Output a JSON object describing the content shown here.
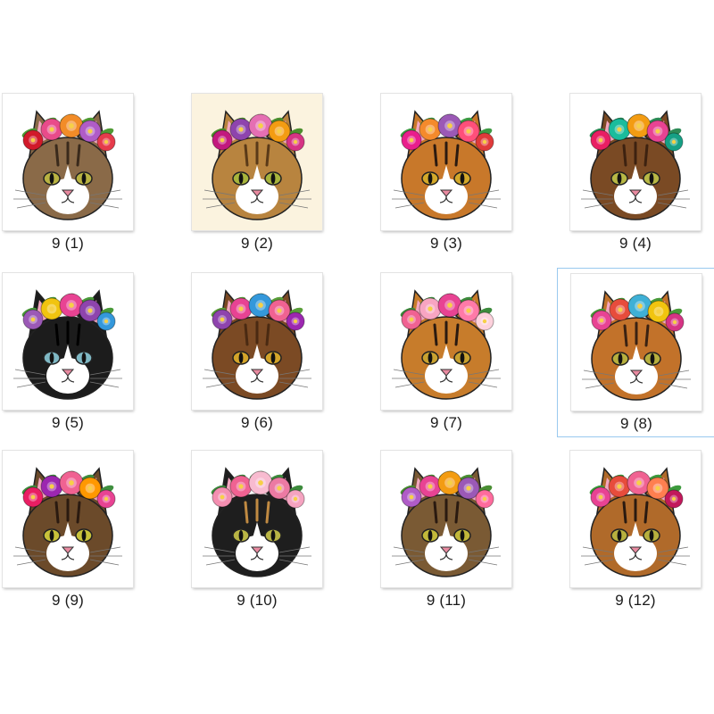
{
  "files": [
    {
      "name": "9 (1)",
      "face": "#8a6a48",
      "stripe": "#3a2a1c",
      "muzzle": "#ffffff",
      "eye": "#b9b342",
      "bg": "#ffffff",
      "flowers": [
        "#d11a2a",
        "#e94b8a",
        "#f28c28",
        "#b05cc7",
        "#e63b4b"
      ],
      "leaves": "#4f9a34",
      "selected": false
    },
    {
      "name": "9 (2)",
      "face": "#b8843f",
      "stripe": "#5a3a18",
      "muzzle": "#ffffff",
      "eye": "#a8b53c",
      "bg": "#fbf3df",
      "flowers": [
        "#c2197e",
        "#8e44ad",
        "#e56fb3",
        "#f39c12",
        "#d63384"
      ],
      "leaves": "#4c8f2e",
      "selected": false
    },
    {
      "name": "9 (3)",
      "face": "#c8782a",
      "stripe": "#2b1a10",
      "muzzle": "#ffffff",
      "eye": "#d4a92a",
      "bg": "#ffffff",
      "flowers": [
        "#e91e8c",
        "#f48a2c",
        "#9b59b6",
        "#ff4f7a",
        "#e03a3a"
      ],
      "leaves": "#3f9b45",
      "selected": false
    },
    {
      "name": "9 (4)",
      "face": "#7a4a24",
      "stripe": "#3d2210",
      "muzzle": "#ffffff",
      "eye": "#b8b845",
      "bg": "#ffffff",
      "flowers": [
        "#e91e63",
        "#1abc9c",
        "#f39c12",
        "#e84393",
        "#16a085"
      ],
      "leaves": "#2e8b57",
      "selected": false
    },
    {
      "name": "9 (5)",
      "face": "#1c1c1c",
      "stripe": "#000000",
      "muzzle": "#ffffff",
      "eye": "#7fb8c4",
      "bg": "#ffffff",
      "flowers": [
        "#9b59b6",
        "#f1c40f",
        "#e84393",
        "#8e44ad",
        "#3498db"
      ],
      "leaves": "#4a9a3a",
      "selected": false
    },
    {
      "name": "9 (6)",
      "face": "#7b4a24",
      "stripe": "#4a2a12",
      "muzzle": "#ffffff",
      "eye": "#d4a52a",
      "bg": "#ffffff",
      "flowers": [
        "#8e44ad",
        "#e84393",
        "#3498db",
        "#f06292",
        "#9c27b0"
      ],
      "leaves": "#5a9e3a",
      "selected": false
    },
    {
      "name": "9 (7)",
      "face": "#c77c2b",
      "stripe": "#2a1a10",
      "muzzle": "#ffffff",
      "eye": "#c9a230",
      "bg": "#ffffff",
      "flowers": [
        "#f06292",
        "#f8a5c2",
        "#e84393",
        "#ff7aa8",
        "#fdd1dc"
      ],
      "leaves": "#3d8b3d",
      "selected": false
    },
    {
      "name": "9 (8)",
      "face": "#c2722a",
      "stripe": "#3a2212",
      "muzzle": "#ffffff",
      "eye": "#b7b03e",
      "bg": "#ffffff",
      "flowers": [
        "#e84393",
        "#e74c3c",
        "#3fb0d6",
        "#f1c40f",
        "#d63384"
      ],
      "leaves": "#4a9a3a",
      "selected": true
    },
    {
      "name": "9 (9)",
      "face": "#6b4a2a",
      "stripe": "#2a1a10",
      "muzzle": "#ffffff",
      "eye": "#c8c23a",
      "bg": "#ffffff",
      "flowers": [
        "#e91e63",
        "#9c27b0",
        "#f06292",
        "#ff9800",
        "#e84393"
      ],
      "leaves": "#3f8f3f",
      "selected": false
    },
    {
      "name": "9 (10)",
      "face": "#1e1e1e",
      "stripe": "#c08a42",
      "muzzle": "#ffffff",
      "eye": "#b9b545",
      "bg": "#ffffff",
      "flowers": [
        "#f48fb1",
        "#f06292",
        "#f8bbd0",
        "#ec7aa3",
        "#f5a3c0"
      ],
      "leaves": "#3d8b3d",
      "selected": false
    },
    {
      "name": "9 (11)",
      "face": "#7a5a34",
      "stripe": "#2a1a10",
      "muzzle": "#ffffff",
      "eye": "#c2b83a",
      "bg": "#ffffff",
      "flowers": [
        "#b05cc7",
        "#e84393",
        "#f39c12",
        "#9b59b6",
        "#ff6b9d"
      ],
      "leaves": "#4a8f34",
      "selected": false
    },
    {
      "name": "9 (12)",
      "face": "#b06a2a",
      "stripe": "#2a1a10",
      "muzzle": "#ffffff",
      "eye": "#b7b03e",
      "bg": "#ffffff",
      "flowers": [
        "#e84393",
        "#e74c3c",
        "#f06292",
        "#ff7f50",
        "#c2185b"
      ],
      "leaves": "#3d9b3d",
      "selected": false
    }
  ]
}
